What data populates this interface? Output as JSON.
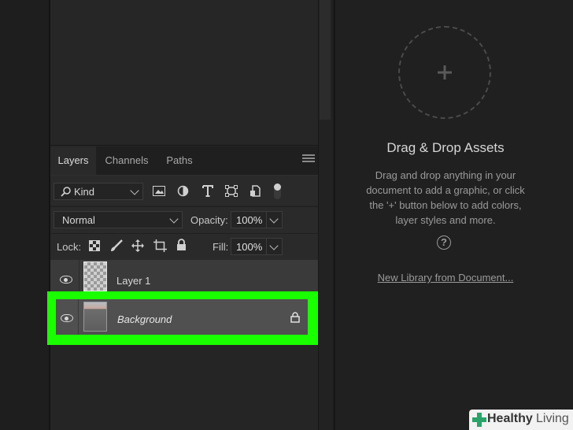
{
  "tabs": [
    "Layers",
    "Channels",
    "Paths"
  ],
  "filter": {
    "kind_label": "Kind"
  },
  "blend": {
    "mode": "Normal",
    "opacity_label": "Opacity:",
    "opacity_value": "100%"
  },
  "lock": {
    "label": "Lock:",
    "fill_label": "Fill:",
    "fill_value": "100%"
  },
  "layers": [
    {
      "name": "Layer 1"
    },
    {
      "name": "Background"
    }
  ],
  "library": {
    "title": "Drag & Drop Assets",
    "desc_lines": [
      "Drag and drop anything in your",
      "document to add a graphic, or click",
      "the '+' button below to add colors,",
      "layer styles and more."
    ],
    "help_glyph": "?",
    "link": "New Library from Document..."
  },
  "watermark": {
    "text1": "Healthy",
    "text2": "Living"
  },
  "colors": {
    "highlight": "#1aff00",
    "panel": "#2a2a2a"
  }
}
